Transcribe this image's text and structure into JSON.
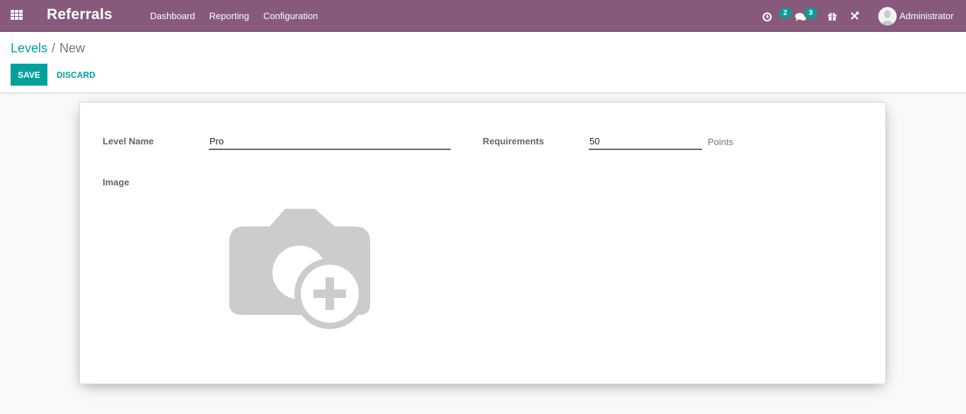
{
  "navbar": {
    "apps_icon": "apps-grid-icon",
    "app_title": "Referrals",
    "menu": [
      {
        "label": "Dashboard"
      },
      {
        "label": "Reporting"
      },
      {
        "label": "Configuration"
      }
    ],
    "systray": {
      "activities": {
        "icon": "clock-icon",
        "badge": "2"
      },
      "messages": {
        "icon": "chat-icon",
        "badge": "3"
      },
      "gift": {
        "icon": "gift-icon"
      },
      "debug": {
        "icon": "tools-icon"
      },
      "user": {
        "icon": "avatar",
        "name": "Administrator"
      }
    },
    "colors": {
      "brand": "#875a7b",
      "accent": "#00a09d"
    }
  },
  "control_panel": {
    "breadcrumb": [
      {
        "label": "Levels"
      },
      {
        "label": "New"
      }
    ],
    "separator": "/",
    "save_label": "Save",
    "discard_label": "Discard"
  },
  "form": {
    "level_name": {
      "label": "Level Name",
      "value": "Pro"
    },
    "requirements": {
      "label": "Requirements",
      "value": "50",
      "suffix": "Points"
    },
    "image": {
      "label": "Image",
      "placeholder_icon": "camera-add-icon"
    }
  }
}
